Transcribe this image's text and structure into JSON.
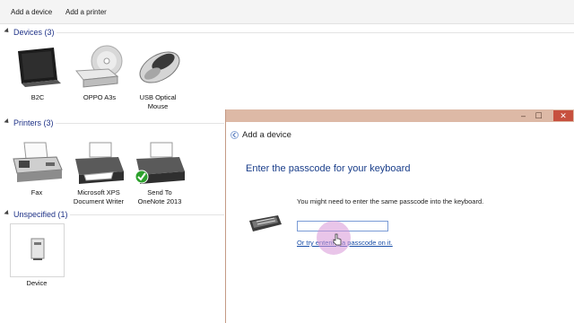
{
  "toolbar": {
    "add_device": "Add a device",
    "add_printer": "Add a printer"
  },
  "sections": {
    "devices": "Devices (3)",
    "printers": "Printers (3)",
    "unspecified": "Unspecified (1)"
  },
  "devices": [
    {
      "label": "B2C",
      "icon": "tablet-icon"
    },
    {
      "label": "OPPO A3s",
      "icon": "optical-drive-icon"
    },
    {
      "label": "USB Optical Mouse",
      "icon": "mouse-icon"
    }
  ],
  "printers": [
    {
      "label": "Fax",
      "icon": "fax-icon"
    },
    {
      "label": "Microsoft XPS Document Writer",
      "icon": "printer-icon"
    },
    {
      "label": "Send To OneNote 2013",
      "icon": "printer-default-icon"
    }
  ],
  "unspecified": [
    {
      "label": "Device",
      "icon": "generic-device-icon"
    }
  ],
  "dialog": {
    "title": "Add a device",
    "heading": "Enter the passcode for your keyboard",
    "instruction": "You might need to enter the same passcode into the keyboard.",
    "passcode_value": "",
    "link": "Or try entering a passcode on it.",
    "close_glyph": "✕",
    "min_glyph": "–",
    "max_glyph": "☐"
  },
  "colors": {
    "accent_title": "#1a3e8a",
    "dialog_frame": "#ddb9a6",
    "close_button": "#c7503e",
    "link": "#1a4fa8"
  }
}
